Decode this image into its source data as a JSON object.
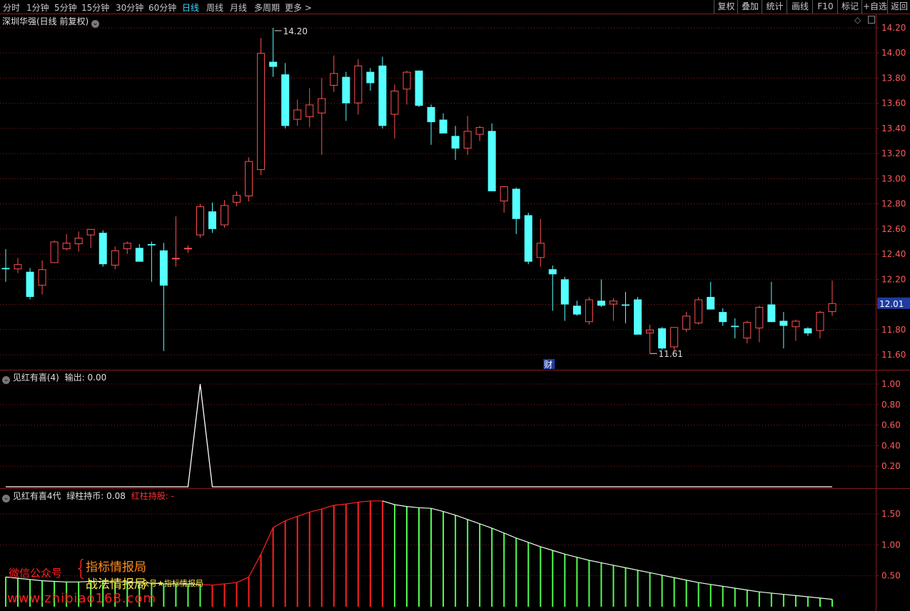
{
  "toolbar": {
    "periods": [
      "分时",
      "1分钟",
      "5分钟",
      "15分钟",
      "30分钟",
      "60分钟",
      "日线",
      "周线",
      "月线",
      "多周期",
      "更多 >"
    ],
    "active": "日线",
    "right_buttons": [
      "复权",
      "叠加",
      "统计",
      "画线",
      "F10",
      "标记",
      "+自选",
      "返回"
    ]
  },
  "main_panel": {
    "title": "深圳华强(日线 前复权)",
    "max_label": "14.20",
    "min_label": "11.61",
    "last_price": "12.01",
    "event_marker": "财"
  },
  "ind1": {
    "title": "见红有喜(4)",
    "output_label": "输出:",
    "output_value": "0.00"
  },
  "ind2": {
    "title": "见红有喜4代",
    "green_label": "绿柱持币:",
    "green_value": "0.08",
    "red_label": "红柱持股:",
    "red_value": "-"
  },
  "watermark": {
    "wechat": "微信公众号",
    "brace": "{",
    "name1": "指标情报局",
    "name2": "战法情报局",
    "small": "众号★指标情报局",
    "url": "www.zhibiao168.com"
  },
  "colors": {
    "up": "#ff5050",
    "down": "#54ffff",
    "grid": "#8a1a1a",
    "axis_text": "#ff5a5a",
    "last_price_bg": "#1f3ca0"
  },
  "chart_data": [
    {
      "type": "candlestick",
      "title": "深圳华强(日线 前复权)",
      "ylim": [
        11.5,
        14.3
      ],
      "yticks": [
        "14.20",
        "14.00",
        "13.80",
        "13.60",
        "13.40",
        "13.20",
        "13.00",
        "12.80",
        "12.60",
        "12.40",
        "12.20",
        "12.00",
        "11.80",
        "11.60"
      ],
      "candles": [
        {
          "o": 12.29,
          "h": 12.44,
          "l": 12.18,
          "c": 12.28
        },
        {
          "o": 12.28,
          "h": 12.37,
          "l": 12.25,
          "c": 12.32
        },
        {
          "o": 12.26,
          "h": 12.29,
          "l": 12.04,
          "c": 12.06
        },
        {
          "o": 12.15,
          "h": 12.35,
          "l": 12.08,
          "c": 12.28
        },
        {
          "o": 12.33,
          "h": 12.51,
          "l": 12.33,
          "c": 12.5
        },
        {
          "o": 12.44,
          "h": 12.56,
          "l": 12.43,
          "c": 12.49
        },
        {
          "o": 12.48,
          "h": 12.58,
          "l": 12.42,
          "c": 12.53
        },
        {
          "o": 12.55,
          "h": 12.6,
          "l": 12.45,
          "c": 12.6
        },
        {
          "o": 12.57,
          "h": 12.59,
          "l": 12.3,
          "c": 12.32
        },
        {
          "o": 12.31,
          "h": 12.46,
          "l": 12.28,
          "c": 12.43
        },
        {
          "o": 12.44,
          "h": 12.5,
          "l": 12.4,
          "c": 12.49
        },
        {
          "o": 12.45,
          "h": 12.48,
          "l": 12.36,
          "c": 12.34
        },
        {
          "o": 12.48,
          "h": 12.5,
          "l": 12.18,
          "c": 12.47
        },
        {
          "o": 12.43,
          "h": 12.49,
          "l": 11.63,
          "c": 12.15
        },
        {
          "o": 12.37,
          "h": 12.7,
          "l": 12.3,
          "c": 12.37
        },
        {
          "o": 12.45,
          "h": 12.47,
          "l": 12.41,
          "c": 12.45
        },
        {
          "o": 12.55,
          "h": 12.8,
          "l": 12.53,
          "c": 12.78
        },
        {
          "o": 12.74,
          "h": 12.81,
          "l": 12.57,
          "c": 12.6
        },
        {
          "o": 12.63,
          "h": 12.83,
          "l": 12.61,
          "c": 12.79
        },
        {
          "o": 12.81,
          "h": 12.9,
          "l": 12.78,
          "c": 12.87
        },
        {
          "o": 12.86,
          "h": 13.17,
          "l": 12.82,
          "c": 13.14
        },
        {
          "o": 13.07,
          "h": 14.12,
          "l": 13.03,
          "c": 14.0
        },
        {
          "o": 13.93,
          "h": 14.2,
          "l": 13.81,
          "c": 13.89
        },
        {
          "o": 13.83,
          "h": 13.92,
          "l": 13.4,
          "c": 13.42
        },
        {
          "o": 13.47,
          "h": 13.63,
          "l": 13.42,
          "c": 13.55
        },
        {
          "o": 13.49,
          "h": 13.72,
          "l": 13.41,
          "c": 13.59
        },
        {
          "o": 13.52,
          "h": 13.8,
          "l": 13.19,
          "c": 13.64
        },
        {
          "o": 13.74,
          "h": 13.98,
          "l": 13.69,
          "c": 13.84
        },
        {
          "o": 13.81,
          "h": 13.85,
          "l": 13.46,
          "c": 13.6
        },
        {
          "o": 13.6,
          "h": 13.95,
          "l": 13.51,
          "c": 13.9
        },
        {
          "o": 13.85,
          "h": 13.88,
          "l": 13.7,
          "c": 13.76
        },
        {
          "o": 13.9,
          "h": 13.97,
          "l": 13.4,
          "c": 13.42
        },
        {
          "o": 13.51,
          "h": 13.75,
          "l": 13.32,
          "c": 13.7
        },
        {
          "o": 13.71,
          "h": 13.86,
          "l": 13.59,
          "c": 13.85
        },
        {
          "o": 13.86,
          "h": 13.86,
          "l": 13.57,
          "c": 13.58
        },
        {
          "o": 13.57,
          "h": 13.59,
          "l": 13.27,
          "c": 13.45
        },
        {
          "o": 13.47,
          "h": 13.52,
          "l": 13.36,
          "c": 13.36
        },
        {
          "o": 13.34,
          "h": 13.42,
          "l": 13.15,
          "c": 13.24
        },
        {
          "o": 13.24,
          "h": 13.5,
          "l": 13.19,
          "c": 13.38
        },
        {
          "o": 13.35,
          "h": 13.42,
          "l": 13.3,
          "c": 13.41
        },
        {
          "o": 13.38,
          "h": 13.44,
          "l": 12.92,
          "c": 12.9
        },
        {
          "o": 12.82,
          "h": 12.83,
          "l": 12.73,
          "c": 12.94
        },
        {
          "o": 12.92,
          "h": 12.93,
          "l": 12.56,
          "c": 12.68
        },
        {
          "o": 12.71,
          "h": 12.73,
          "l": 12.32,
          "c": 12.34
        },
        {
          "o": 12.37,
          "h": 12.68,
          "l": 12.3,
          "c": 12.49
        },
        {
          "o": 12.28,
          "h": 12.31,
          "l": 11.95,
          "c": 12.24
        },
        {
          "o": 12.2,
          "h": 12.22,
          "l": 11.87,
          "c": 12.0
        },
        {
          "o": 11.99,
          "h": 12.03,
          "l": 11.91,
          "c": 11.92
        },
        {
          "o": 11.86,
          "h": 12.06,
          "l": 11.84,
          "c": 12.04
        },
        {
          "o": 12.03,
          "h": 12.2,
          "l": 11.98,
          "c": 11.99
        },
        {
          "o": 12.0,
          "h": 12.05,
          "l": 11.87,
          "c": 12.03
        },
        {
          "o": 12.0,
          "h": 12.1,
          "l": 11.85,
          "c": 11.99
        },
        {
          "o": 12.04,
          "h": 12.06,
          "l": 11.77,
          "c": 11.76
        },
        {
          "o": 11.77,
          "h": 11.84,
          "l": 11.61,
          "c": 11.8
        },
        {
          "o": 11.81,
          "h": 11.82,
          "l": 11.64,
          "c": 11.65
        },
        {
          "o": 11.66,
          "h": 11.82,
          "l": 11.63,
          "c": 11.82
        },
        {
          "o": 11.8,
          "h": 11.94,
          "l": 11.78,
          "c": 11.91
        },
        {
          "o": 11.85,
          "h": 12.06,
          "l": 11.84,
          "c": 12.04
        },
        {
          "o": 12.06,
          "h": 12.18,
          "l": 11.96,
          "c": 11.96
        },
        {
          "o": 11.94,
          "h": 11.97,
          "l": 11.83,
          "c": 11.86
        },
        {
          "o": 11.83,
          "h": 11.89,
          "l": 11.73,
          "c": 11.82
        },
        {
          "o": 11.73,
          "h": 11.87,
          "l": 11.69,
          "c": 11.86
        },
        {
          "o": 11.81,
          "h": 11.99,
          "l": 11.7,
          "c": 11.98
        },
        {
          "o": 12.0,
          "h": 12.18,
          "l": 11.86,
          "c": 11.86
        },
        {
          "o": 11.87,
          "h": 11.94,
          "l": 11.65,
          "c": 11.83
        },
        {
          "o": 11.82,
          "h": 11.88,
          "l": 11.71,
          "c": 11.87
        },
        {
          "o": 11.81,
          "h": 11.82,
          "l": 11.75,
          "c": 11.77
        },
        {
          "o": 11.79,
          "h": 11.95,
          "l": 11.73,
          "c": 11.94
        },
        {
          "o": 11.94,
          "h": 12.19,
          "l": 11.91,
          "c": 12.01
        }
      ]
    },
    {
      "type": "line",
      "title": "见红有喜(4)",
      "ylim": [
        0,
        1.1
      ],
      "yticks": [
        "1.00",
        "0.80",
        "0.60",
        "0.40",
        "0.20"
      ],
      "values": [
        0,
        0,
        0,
        0,
        0,
        0,
        0,
        0,
        0,
        0,
        0,
        0,
        0,
        0,
        0,
        0,
        1,
        0,
        0,
        0,
        0,
        0,
        0,
        0,
        0,
        0,
        0,
        0,
        0,
        0,
        0,
        0,
        0,
        0,
        0,
        0,
        0,
        0,
        0,
        0,
        0,
        0,
        0,
        0,
        0,
        0,
        0,
        0,
        0,
        0,
        0,
        0,
        0,
        0,
        0,
        0,
        0,
        0,
        0,
        0,
        0,
        0,
        0,
        0,
        0,
        0,
        0,
        0,
        0
      ]
    },
    {
      "type": "bar",
      "title": "见红有喜4代",
      "ylim": [
        0,
        1.9
      ],
      "yticks": [
        "1.50",
        "1.00",
        "0.50"
      ],
      "values": [
        0.48,
        0.46,
        0.44,
        0.42,
        0.41,
        0.4,
        0.4,
        0.41,
        0.41,
        0.4,
        0.4,
        0.39,
        0.38,
        0.37,
        0.37,
        0.37,
        0.36,
        0.35,
        0.37,
        0.39,
        0.48,
        0.85,
        1.28,
        1.39,
        1.46,
        1.53,
        1.58,
        1.64,
        1.66,
        1.69,
        1.71,
        1.71,
        1.65,
        1.62,
        1.6,
        1.59,
        1.54,
        1.48,
        1.41,
        1.34,
        1.27,
        1.19,
        1.11,
        1.04,
        0.97,
        0.91,
        0.85,
        0.8,
        0.75,
        0.71,
        0.67,
        0.63,
        0.59,
        0.55,
        0.51,
        0.47,
        0.43,
        0.39,
        0.36,
        0.33,
        0.3,
        0.27,
        0.24,
        0.22,
        0.2,
        0.18,
        0.16,
        0.14,
        0.12
      ],
      "colors": [
        "green",
        "green",
        "green",
        "green",
        "green",
        "green",
        "green",
        "green",
        "green",
        "green",
        "green",
        "green",
        "green",
        "green",
        "green",
        "green",
        "green",
        "red",
        "red",
        "red",
        "red",
        "red",
        "red",
        "red",
        "red",
        "red",
        "red",
        "red",
        "red",
        "red",
        "red",
        "red",
        "green",
        "green",
        "green",
        "green",
        "green",
        "green",
        "green",
        "green",
        "green",
        "green",
        "green",
        "green",
        "green",
        "green",
        "green",
        "green",
        "green",
        "green",
        "green",
        "green",
        "green",
        "green",
        "green",
        "green",
        "green",
        "green",
        "green",
        "green",
        "green",
        "green",
        "green",
        "green",
        "green",
        "green",
        "green",
        "green",
        "green"
      ]
    }
  ]
}
